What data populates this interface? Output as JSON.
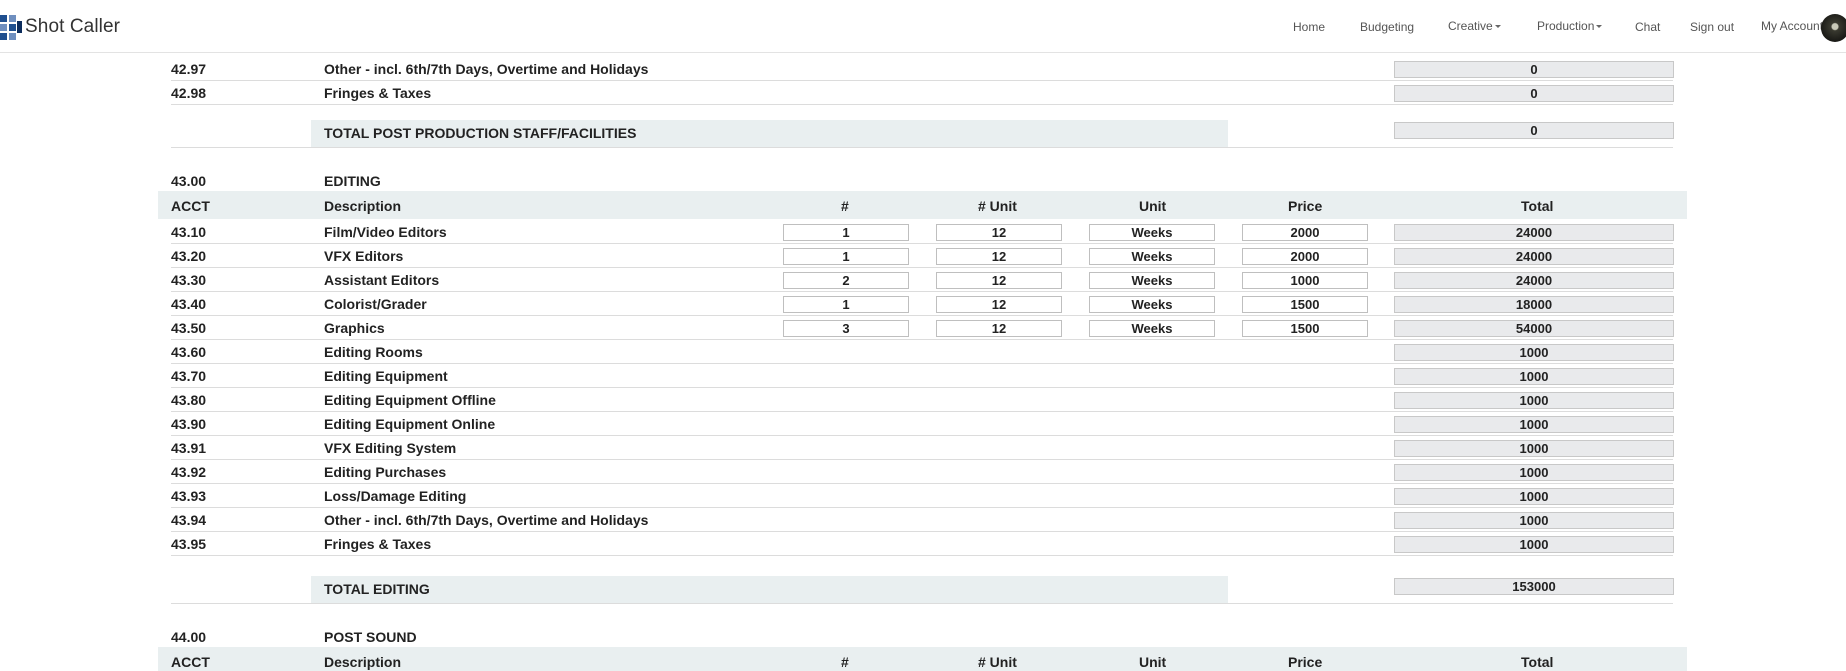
{
  "nav": {
    "brand": "Shot Caller",
    "home": "Home",
    "budgeting": "Budgeting",
    "creative": "Creative",
    "production": "Production",
    "chat": "Chat",
    "sign_out": "Sign out",
    "my_account": "My Account"
  },
  "columns": {
    "acct": "ACCT",
    "description": "Description",
    "num": "#",
    "num_unit": "# Unit",
    "unit": "Unit",
    "price": "Price",
    "total": "Total"
  },
  "post_staff": {
    "rows": [
      {
        "acct": "42.97",
        "description": "Other - incl. 6th/7th Days, Overtime and Holidays",
        "total": "0"
      },
      {
        "acct": "42.98",
        "description": "Fringes & Taxes",
        "total": "0"
      }
    ],
    "total_label": "TOTAL POST PRODUCTION STAFF/FACILITIES",
    "total_value": "0"
  },
  "editing": {
    "acct": "43.00",
    "title": "EDITING",
    "detail_rows": [
      {
        "acct": "43.10",
        "description": "Film/Video Editors",
        "num": "1",
        "num_unit": "12",
        "unit": "Weeks",
        "price": "2000",
        "total": "24000"
      },
      {
        "acct": "43.20",
        "description": "VFX Editors",
        "num": "1",
        "num_unit": "12",
        "unit": "Weeks",
        "price": "2000",
        "total": "24000"
      },
      {
        "acct": "43.30",
        "description": "Assistant Editors",
        "num": "2",
        "num_unit": "12",
        "unit": "Weeks",
        "price": "1000",
        "total": "24000"
      },
      {
        "acct": "43.40",
        "description": "Colorist/Grader",
        "num": "1",
        "num_unit": "12",
        "unit": "Weeks",
        "price": "1500",
        "total": "18000"
      },
      {
        "acct": "43.50",
        "description": "Graphics",
        "num": "3",
        "num_unit": "12",
        "unit": "Weeks",
        "price": "1500",
        "total": "54000"
      }
    ],
    "simple_rows": [
      {
        "acct": "43.60",
        "description": "Editing Rooms",
        "total": "1000"
      },
      {
        "acct": "43.70",
        "description": "Editing Equipment",
        "total": "1000"
      },
      {
        "acct": "43.80",
        "description": "Editing Equipment Offline",
        "total": "1000"
      },
      {
        "acct": "43.90",
        "description": "Editing Equipment Online",
        "total": "1000"
      },
      {
        "acct": "43.91",
        "description": "VFX Editing System",
        "total": "1000"
      },
      {
        "acct": "43.92",
        "description": "Editing Purchases",
        "total": "1000"
      },
      {
        "acct": "43.93",
        "description": "Loss/Damage Editing",
        "total": "1000"
      },
      {
        "acct": "43.94",
        "description": "Other - incl. 6th/7th Days, Overtime and Holidays",
        "total": "1000"
      },
      {
        "acct": "43.95",
        "description": "Fringes & Taxes",
        "total": "1000"
      }
    ],
    "total_label": "TOTAL EDITING",
    "total_value": "153000"
  },
  "post_sound": {
    "acct": "44.00",
    "title": "POST SOUND"
  }
}
